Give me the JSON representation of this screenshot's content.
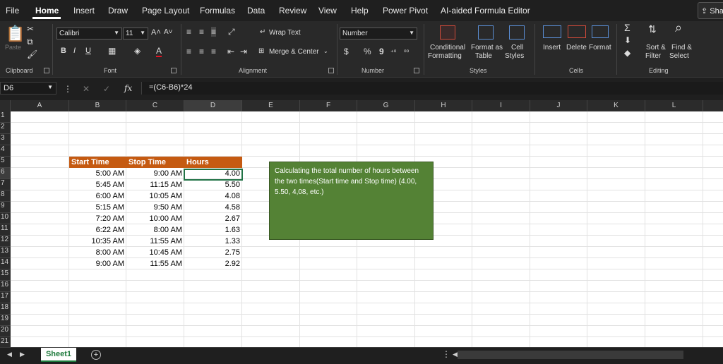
{
  "menu": {
    "items": [
      "File",
      "Home",
      "Insert",
      "Draw",
      "Page Layout",
      "Formulas",
      "Data",
      "Review",
      "View",
      "Help",
      "Power Pivot",
      "AI-aided Formula Editor"
    ],
    "active": "Home",
    "share_label": "Sha"
  },
  "ribbon": {
    "clipboard": {
      "paste_label": "Paste",
      "group": "Clipboard"
    },
    "font": {
      "name": "Calibri",
      "size": "11",
      "bold": "B",
      "italic": "I",
      "underline": "U",
      "grow": "A˄",
      "shrink": "A˅",
      "group": "Font"
    },
    "alignment": {
      "wrap_text": "Wrap Text",
      "merge_center": "Merge & Center",
      "group": "Alignment"
    },
    "number": {
      "format": "Number",
      "currency": "$",
      "percent": "%",
      "comma": "9",
      "group": "Number"
    },
    "styles": {
      "conditional": [
        "Conditional",
        "Formatting"
      ],
      "format_table": [
        "Format as",
        "Table"
      ],
      "cell_styles": [
        "Cell",
        "Styles"
      ],
      "group": "Styles"
    },
    "cells": {
      "insert": "Insert",
      "delete": "Delete",
      "format": "Format",
      "group": "Cells"
    },
    "editing": {
      "sort_filter": [
        "Sort &",
        "Filter"
      ],
      "find_select": [
        "Find &",
        "Select"
      ],
      "group": "Editing"
    }
  },
  "formula_bar": {
    "name_box": "D6",
    "fx": "fx",
    "formula": "=(C6-B6)*24"
  },
  "grid": {
    "columns": [
      "A",
      "B",
      "C",
      "D",
      "E",
      "F",
      "G",
      "H",
      "I",
      "J",
      "K",
      "L"
    ],
    "rows": [
      "1",
      "2",
      "3",
      "4",
      "5",
      "6",
      "7",
      "8",
      "9",
      "10",
      "11",
      "12",
      "13",
      "14",
      "15",
      "16",
      "17",
      "18",
      "19",
      "20",
      "21"
    ],
    "table_headers": [
      "Start Time",
      "Stop Time",
      "Hours"
    ],
    "table_rows": [
      [
        "5:00 AM",
        "9:00 AM",
        "4.00"
      ],
      [
        "5:45 AM",
        "11:15 AM",
        "5.50"
      ],
      [
        "6:00 AM",
        "10:05 AM",
        "4.08"
      ],
      [
        "5:15 AM",
        "9:50 AM",
        "4.58"
      ],
      [
        "7:20 AM",
        "10:00 AM",
        "2.67"
      ],
      [
        "6:22 AM",
        "8:00 AM",
        "1.63"
      ],
      [
        "10:35 AM",
        "11:55 AM",
        "1.33"
      ],
      [
        "8:00 AM",
        "10:45 AM",
        "2.75"
      ],
      [
        "9:00 AM",
        "11:55 AM",
        "2.92"
      ]
    ],
    "note": "Calculating the total number of hours between the two times(Start time and Stop time) (4.00, 5.50, 4,08, etc.)"
  },
  "colors": {
    "table_header_bg": "#c55a11",
    "note_bg": "#548235",
    "sheet_tab_text": "#1e7a3c"
  },
  "sheets": {
    "active": "Sheet1",
    "add_icon": "+"
  }
}
